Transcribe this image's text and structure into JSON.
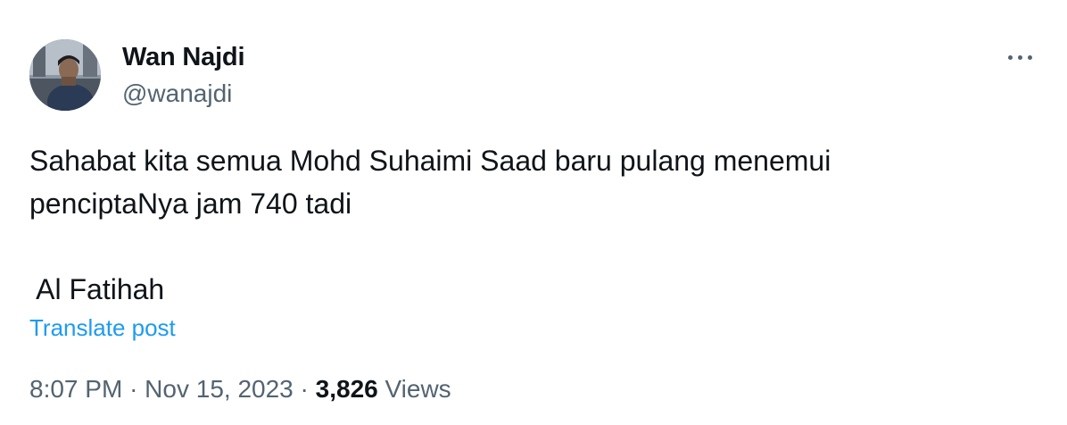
{
  "author": {
    "display_name": "Wan Najdi",
    "handle": "@wanajdi",
    "avatar_icon": "user-photo-avatar"
  },
  "post": {
    "lines": [
      "Sahabat kita semua Mohd Suhaimi Saad baru pulang menemui",
      "penciptaNya jam 740 tadi",
      "",
      " Al Fatihah"
    ],
    "translate_label": "Translate post"
  },
  "meta": {
    "time": "8:07 PM",
    "separator": "·",
    "date": "Nov 15, 2023",
    "views_count": "3,826",
    "views_label": "Views"
  },
  "actions": {
    "more_icon": "more-horizontal-icon"
  },
  "colors": {
    "text_primary": "#0f1419",
    "text_secondary": "#536471",
    "link": "#1d9bf0",
    "background": "#ffffff"
  }
}
